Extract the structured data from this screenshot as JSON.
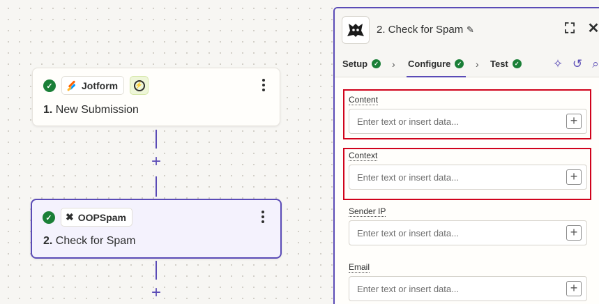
{
  "canvas": {
    "steps": [
      {
        "app_name": "Jotform",
        "number": "1.",
        "title": "New Submission"
      },
      {
        "app_name": "OOPSpam",
        "number": "2.",
        "title": "Check for Spam"
      }
    ]
  },
  "panel": {
    "title": "2. Check for Spam",
    "tabs": [
      {
        "label": "Setup"
      },
      {
        "label": "Configure"
      },
      {
        "label": "Test"
      }
    ],
    "fields": [
      {
        "label": "Content",
        "placeholder": "Enter text or insert data..."
      },
      {
        "label": "Context",
        "placeholder": "Enter text or insert data..."
      },
      {
        "label": "Sender IP",
        "placeholder": "Enter text or insert data..."
      },
      {
        "label": "Email",
        "placeholder": "Enter text or insert data..."
      }
    ]
  },
  "colors": {
    "accent": "#5a4bb6",
    "success": "#1a7f37",
    "highlight": "#d0021b",
    "canvas_bg": "#f7f6f3"
  },
  "icons": [
    "check-circle-icon",
    "jotform-logo-icon",
    "trigger-bolt-icon",
    "kebab-menu-icon",
    "oopspam-logo-icon",
    "pencil-icon",
    "expand-icon",
    "close-icon",
    "ai-sparkle-icon",
    "undo-icon",
    "search-icon",
    "add-icon"
  ]
}
